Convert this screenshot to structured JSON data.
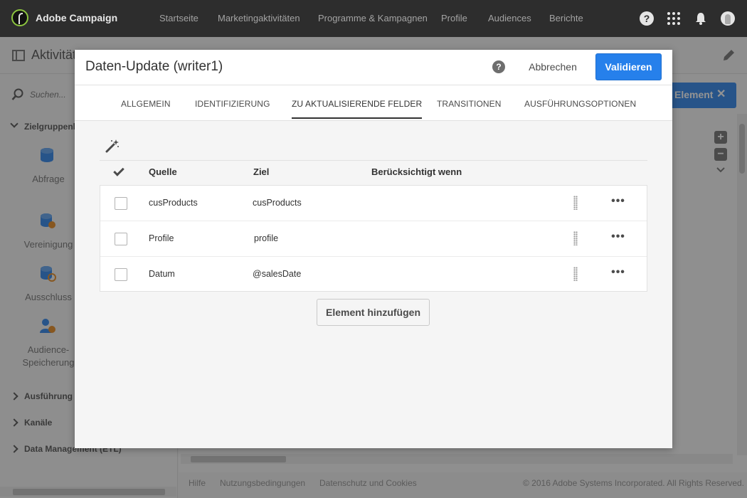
{
  "app": {
    "brand": "Adobe Campaign"
  },
  "nav": {
    "items": [
      "Startseite",
      "Marketingaktivitäten",
      "Programme & Kampagnen",
      "Profile",
      "Audiences",
      "Berichte"
    ],
    "help_glyph": "?",
    "icons": [
      "help-icon",
      "apps-grid-icon",
      "bell-icon",
      "user-avatar-icon"
    ]
  },
  "page": {
    "title": "Aktivitäten",
    "search_placeholder": "Suchen...",
    "sections": {
      "targeting": "Zielgruppenbestimmung",
      "execution": "Ausführung",
      "channels": "Kanäle",
      "data_management": "Data Management (ETL)"
    },
    "activities": [
      {
        "label": "Abfrage",
        "icon": "query-icon"
      },
      {
        "label": "Vereinigung",
        "icon": "union-icon"
      },
      {
        "label": "Ausschluss",
        "icon": "exclusion-icon"
      },
      {
        "label": "Audience-Speicherung",
        "icon": "save-audience-icon"
      }
    ],
    "peek_button": "Element",
    "footer": {
      "help": "Hilfe",
      "terms": "Nutzungsbedingungen",
      "privacy": "Datenschutz und Cookies",
      "copyright": "© 2016 Adobe Systems Incorporated. All Rights Reserved."
    }
  },
  "modal": {
    "title": "Daten-Update (writer1)",
    "help_glyph": "?",
    "cancel_label": "Abbrechen",
    "validate_label": "Validieren",
    "tabs": [
      "ALLGEMEIN",
      "IDENTIFIZIERUNG",
      "ZU AKTUALISIERENDE FELDER",
      "TRANSITIONEN",
      "AUSFÜHRUNGSOPTIONEN"
    ],
    "active_tab": "ZU AKTUALISIERENDE FELDER",
    "columns": {
      "source": "Quelle",
      "target": "Ziel",
      "condition": "Berücksichtigt wenn"
    },
    "rows": [
      {
        "source": "cusProducts",
        "target": "cusProducts",
        "condition": ""
      },
      {
        "source": "Profile",
        "target": "profile",
        "condition": ""
      },
      {
        "source": "Datum",
        "target": "@salesDate",
        "condition": ""
      }
    ],
    "more_glyph": "•••",
    "add_label": "Element hinzufügen"
  },
  "colors": {
    "accent": "#2680eb",
    "topbar": "#2d2d2d",
    "logo_ring": "#8dc63f",
    "modal_bg": "#f5f5f5"
  }
}
